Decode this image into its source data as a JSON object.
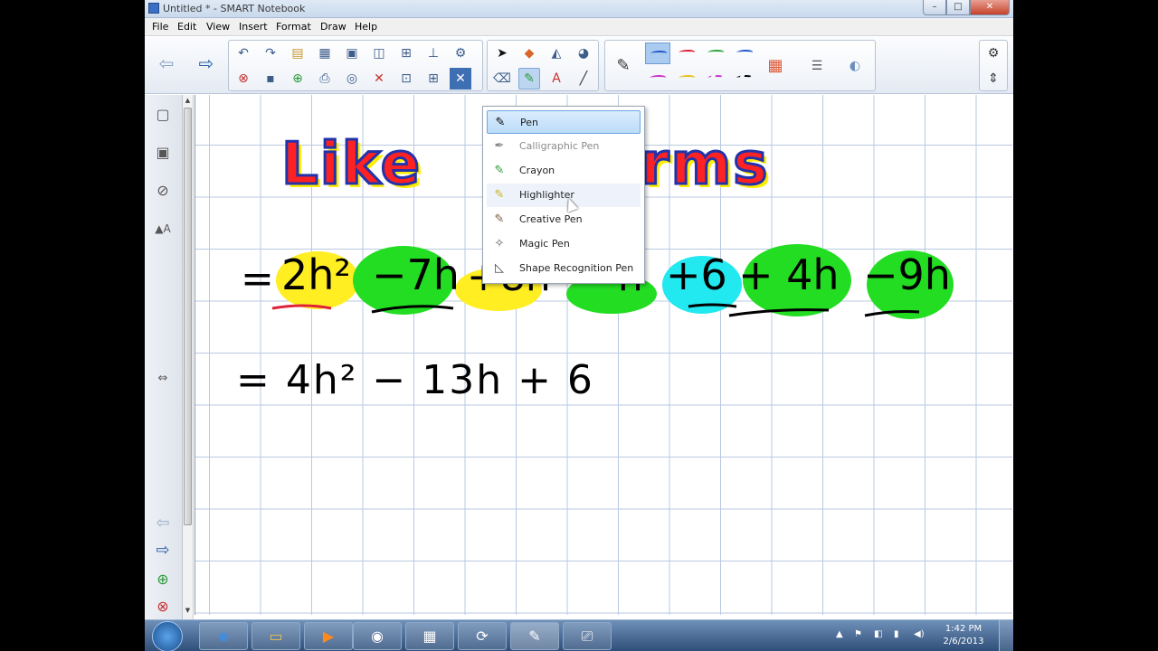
{
  "window": {
    "title": "Untitled * - SMART Notebook",
    "min": "–",
    "max": "□",
    "close": "✕"
  },
  "menu": [
    "File",
    "Edit",
    "View",
    "Insert",
    "Format",
    "Draw",
    "Help"
  ],
  "pen_menu": {
    "items": [
      {
        "label": "Pen",
        "icon": "pen-icon",
        "state": "selected"
      },
      {
        "label": "Calligraphic Pen",
        "icon": "calligraphic-pen-icon",
        "state": "disabled"
      },
      {
        "label": "Crayon",
        "icon": "crayon-icon",
        "state": "normal"
      },
      {
        "label": "Highlighter",
        "icon": "highlighter-icon",
        "state": "hover"
      },
      {
        "label": "Creative Pen",
        "icon": "creative-pen-icon",
        "state": "normal"
      },
      {
        "label": "Magic Pen",
        "icon": "magic-pen-icon",
        "state": "normal"
      },
      {
        "label": "Shape Recognition Pen",
        "icon": "shape-recognition-pen-icon",
        "state": "normal"
      }
    ]
  },
  "pen_colors": [
    "#1e56c9",
    "#e0203a",
    "#2aa33a",
    "#1e56c9",
    "#cc33cc",
    "#e8c21a",
    "#cc33cc",
    "#000000"
  ],
  "canvas": {
    "heading_left": "Like",
    "heading_right": "rms",
    "line1": [
      "=",
      "2h²",
      "−7h",
      "+8h",
      "−h",
      "+6",
      "+ 4h",
      "−9h"
    ],
    "line2": "= 4h² − 13h + 6"
  },
  "colors": {
    "highlight_yellow": "#ffee22",
    "highlight_green": "#22dd22",
    "highlight_cyan": "#22e8f0",
    "heading_fill": "#ff2222",
    "heading_outline": "#ffee00",
    "heading_shadow": "#2233aa"
  },
  "taskbar": {
    "clock_time": "1:42 PM",
    "clock_date": "2/6/2013"
  }
}
